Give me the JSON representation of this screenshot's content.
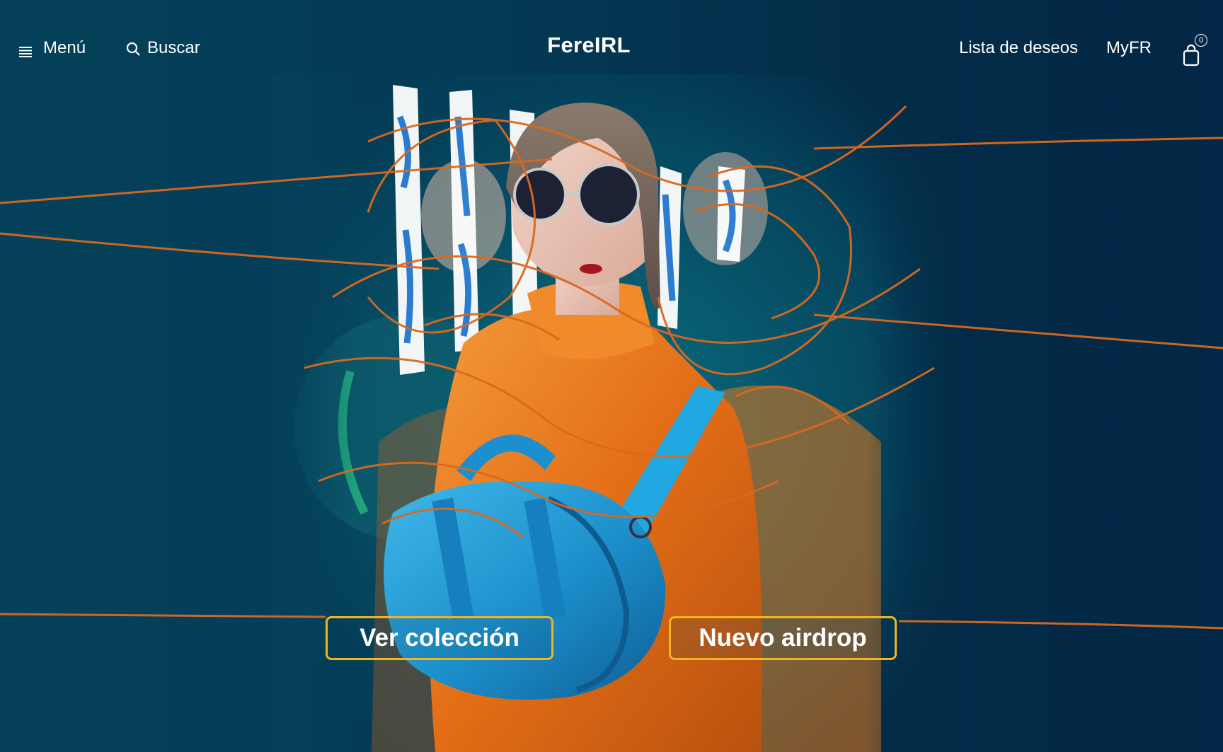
{
  "header": {
    "menu_label": "Menú",
    "search_label": "Buscar",
    "brand": "FereIRL",
    "wishlist_label": "Lista de deseos",
    "account_label": "MyFR",
    "cart_count": "0"
  },
  "hero": {
    "primary_cta": "Ver colección",
    "secondary_cta": "Nuevo airdrop",
    "image_icon": "fashion-model-with-blue-bag-image"
  },
  "colors": {
    "background": "#04384f",
    "accent_border": "#f2b41f",
    "scribble": "#d9691f",
    "bag_blue": "#1f9bd6",
    "jacket_orange": "#e8731c"
  },
  "icons": {
    "menu": "hamburger-icon",
    "search": "search-icon",
    "cart": "shopping-bag-icon"
  }
}
